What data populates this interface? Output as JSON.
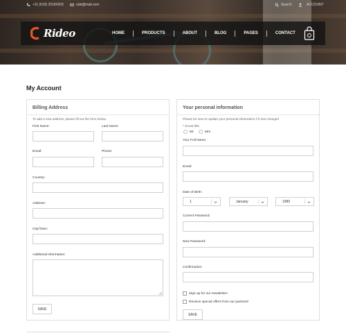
{
  "topbar": {
    "phone": "+11 (019) 25184203",
    "email": "rabi@mail.com",
    "search_label": "Search",
    "account_label": "ACCOUNT"
  },
  "brand": {
    "name": "Rideo"
  },
  "nav": {
    "items": [
      "HOME",
      "PRODUCTS",
      "ABOUT",
      "BLOG",
      "PAGES",
      "CONTACT"
    ]
  },
  "page": {
    "title": "My Account"
  },
  "billing": {
    "heading": "Billing Address",
    "note": "To add a new address, please fill out the form below.",
    "first_name_label": "First Name:",
    "last_name_label": "Last Name:",
    "email_label": "Email:",
    "phone_label": "Phone:",
    "country_label": "Country:",
    "address_label": "Address:",
    "city_label": "City/Town:",
    "additional_label": "Additional information:",
    "save_label": "SAVE"
  },
  "personal": {
    "heading": "Your personal information",
    "note": "Please be sure to update your personal information if it has changed",
    "social_title_label": "* Social title",
    "mr_label": "Mr.",
    "mrs_label": "Mrs.",
    "full_name_label": "Your Full Name:",
    "email_label": "Email:",
    "dob_label": "Date of Birth:",
    "dob_day": "1",
    "dob_month": "January",
    "dob_year": "1990",
    "current_password_label": "Current Password:",
    "new_password_label": "New Password:",
    "confirmation_label": "Confirmation:",
    "newsletter_label": "Sign up for our newsletter!",
    "offers_label": "Receive special offers from our partners!",
    "save_label": "SAVE"
  },
  "icons": {
    "phone": "phone-icon",
    "mail": "mail-icon",
    "search": "search-icon",
    "user": "user-icon",
    "cart": "shopping-bag-icon",
    "caret": "chevron-down-icon"
  },
  "colors": {
    "brand_accent": "#e0562a",
    "navbar_bg": "#141414"
  }
}
